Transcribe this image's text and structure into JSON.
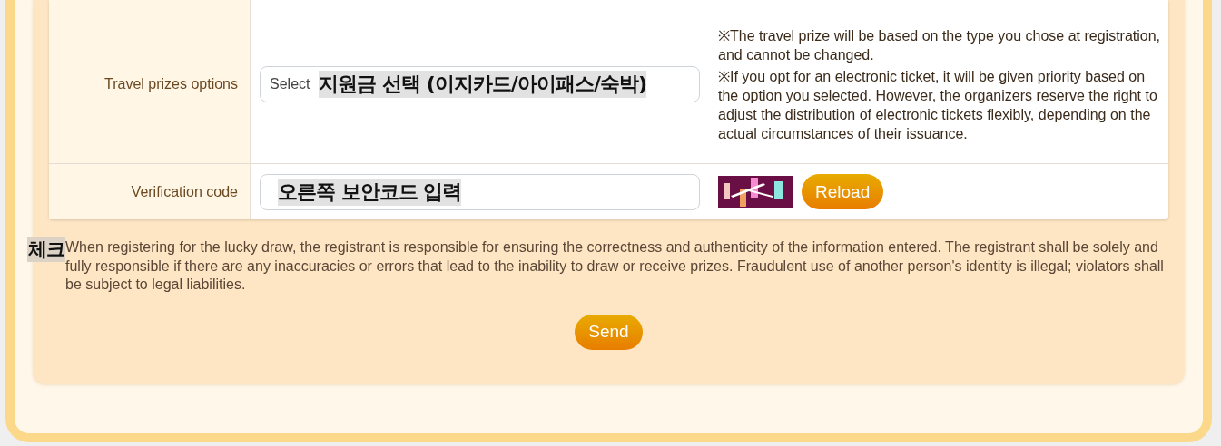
{
  "form": {
    "rows": [
      {
        "kind": "select",
        "label": "Travel prizes options",
        "value": "Select",
        "overlay": "지원금 선택 (이지카드/아이패스/숙박)",
        "notes": [
          "※The travel prize will be based on the type you chose at registration, and cannot be changed.",
          "※If you opt for an electronic ticket, it will be given priority based on the option you selected. However, the organizers reserve the right to adjust the distribution of electronic tickets flexibly, depending on the actual circumstances of their issuance."
        ]
      },
      {
        "kind": "captcha",
        "label": "Verification code",
        "overlay": "오른쪽 보안코드 입력",
        "button": "Reload"
      }
    ]
  },
  "agreement": {
    "label": "체크",
    "text": "When registering for the lucky draw, the registrant is responsible for ensuring the correctness and authenticity of the information entered. The registrant shall be solely and fully responsible if there are any inaccuracies or errors that lead to the inability to draw or receive prizes. Fraudulent use of another person's identity is illegal; violators shall be subject to legal liabilities."
  },
  "send_button": "Send"
}
